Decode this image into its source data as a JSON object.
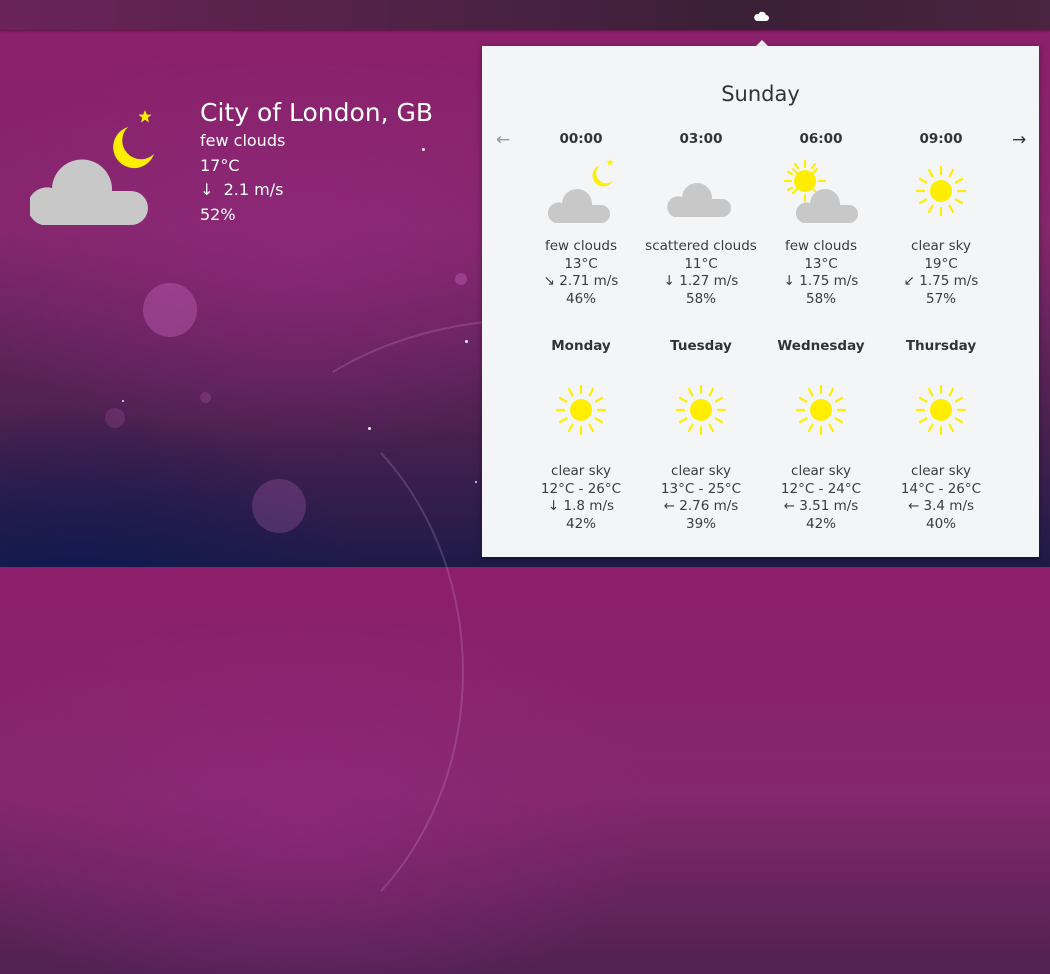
{
  "topbar": {
    "tray_icon": "cloud-icon"
  },
  "desktop_widget": {
    "city": "City of London, GB",
    "condition": "few clouds",
    "temperature": "17°C",
    "wind": "↓  2.1 m/s",
    "humidity": "52%",
    "icon": "cloud-night-icon"
  },
  "panel": {
    "title": "Sunday",
    "prev_icon": "←",
    "next_icon": "→",
    "hourly": [
      {
        "time": "00:00",
        "icon": "cloud-night-icon",
        "condition": "few clouds",
        "temp": "13°C",
        "wind": "↘ 2.71 m/s",
        "humidity": "46%"
      },
      {
        "time": "03:00",
        "icon": "cloud-icon",
        "condition": "scattered clouds",
        "temp": "11°C",
        "wind": "↓ 1.27 m/s",
        "humidity": "58%"
      },
      {
        "time": "06:00",
        "icon": "cloud-sun-icon",
        "condition": "few clouds",
        "temp": "13°C",
        "wind": "↓  1.75 m/s",
        "humidity": "58%"
      },
      {
        "time": "09:00",
        "icon": "sun-icon",
        "condition": "clear sky",
        "temp": "19°C",
        "wind": "↙ 1.75 m/s",
        "humidity": "57%"
      }
    ],
    "daily": [
      {
        "day": "Monday",
        "icon": "sun-icon",
        "condition": "clear sky",
        "temp": "12°C - 26°C",
        "wind": "↓  1.8 m/s",
        "humidity": "42%"
      },
      {
        "day": "Tuesday",
        "icon": "sun-icon",
        "condition": "clear sky",
        "temp": "13°C - 25°C",
        "wind": "← 2.76 m/s",
        "humidity": "39%"
      },
      {
        "day": "Wednesday",
        "icon": "sun-icon",
        "condition": "clear sky",
        "temp": "12°C - 24°C",
        "wind": "← 3.51 m/s",
        "humidity": "42%"
      },
      {
        "day": "Thursday",
        "icon": "sun-icon",
        "condition": "clear sky",
        "temp": "14°C - 26°C",
        "wind": "← 3.4 m/s",
        "humidity": "40%"
      }
    ]
  },
  "colors": {
    "sun": "#ffee00",
    "cloud": "#c8c8c8",
    "panel_bg": "#f4f5f7"
  }
}
